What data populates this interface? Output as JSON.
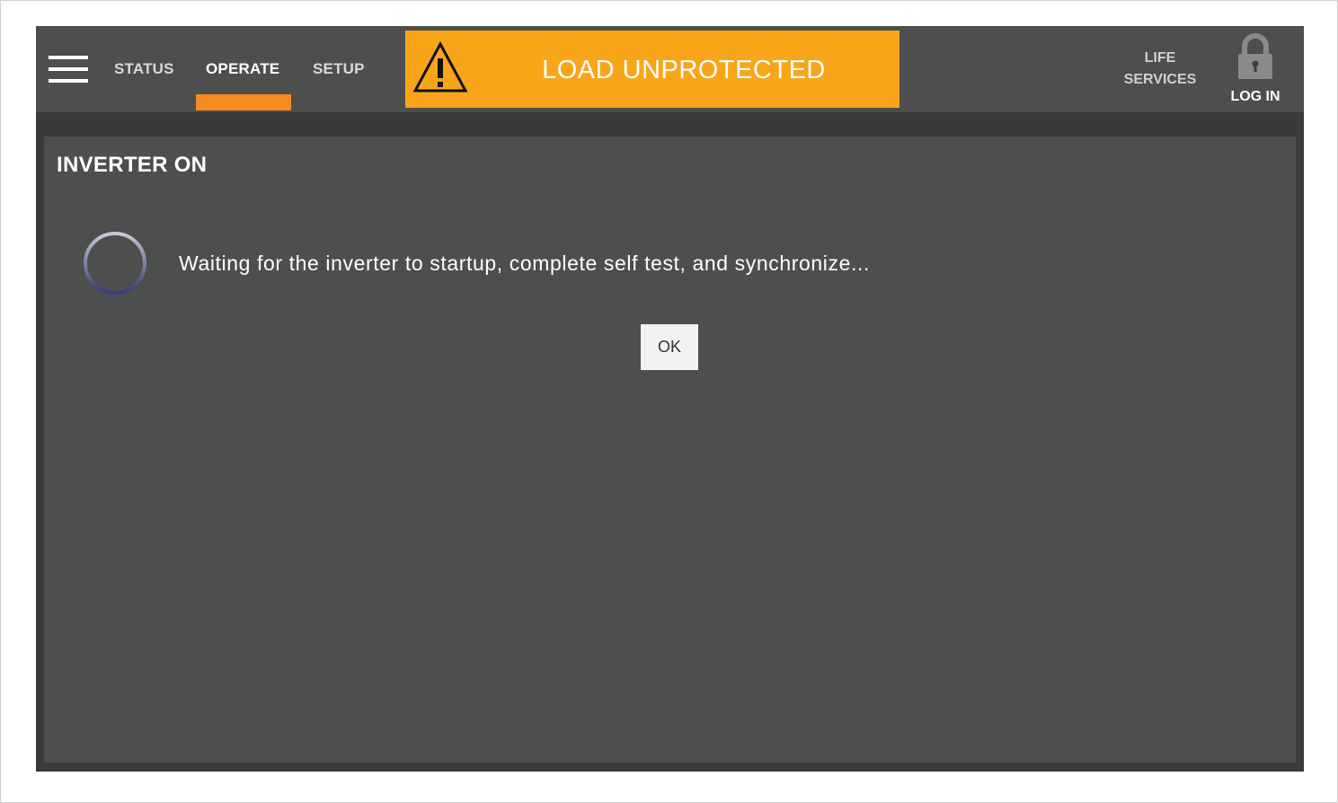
{
  "header": {
    "menu_icon": "hamburger-menu-icon",
    "tabs": [
      {
        "label": "STATUS",
        "active": false
      },
      {
        "label": "OPERATE",
        "active": true
      },
      {
        "label": "SETUP",
        "active": false
      }
    ],
    "active_tab_color": "#f68b1f",
    "alarm": {
      "icon": "warning-triangle-icon",
      "text": "LOAD UNPROTECTED",
      "background": "#f9a51a"
    },
    "life_services": {
      "line1": "LIFE",
      "line2": "SERVICES"
    },
    "login": {
      "icon": "lock-icon",
      "label": "LOG IN"
    }
  },
  "panel": {
    "title": "INVERTER ON",
    "spinner_icon": "loading-spinner-icon",
    "message": "Waiting for the inverter to startup, complete self test, and synchronize...",
    "ok_label": "OK"
  },
  "colors": {
    "topbar": "#4d4e4e",
    "panel": "#4d4f4e",
    "frame": "#3a3a3a"
  }
}
